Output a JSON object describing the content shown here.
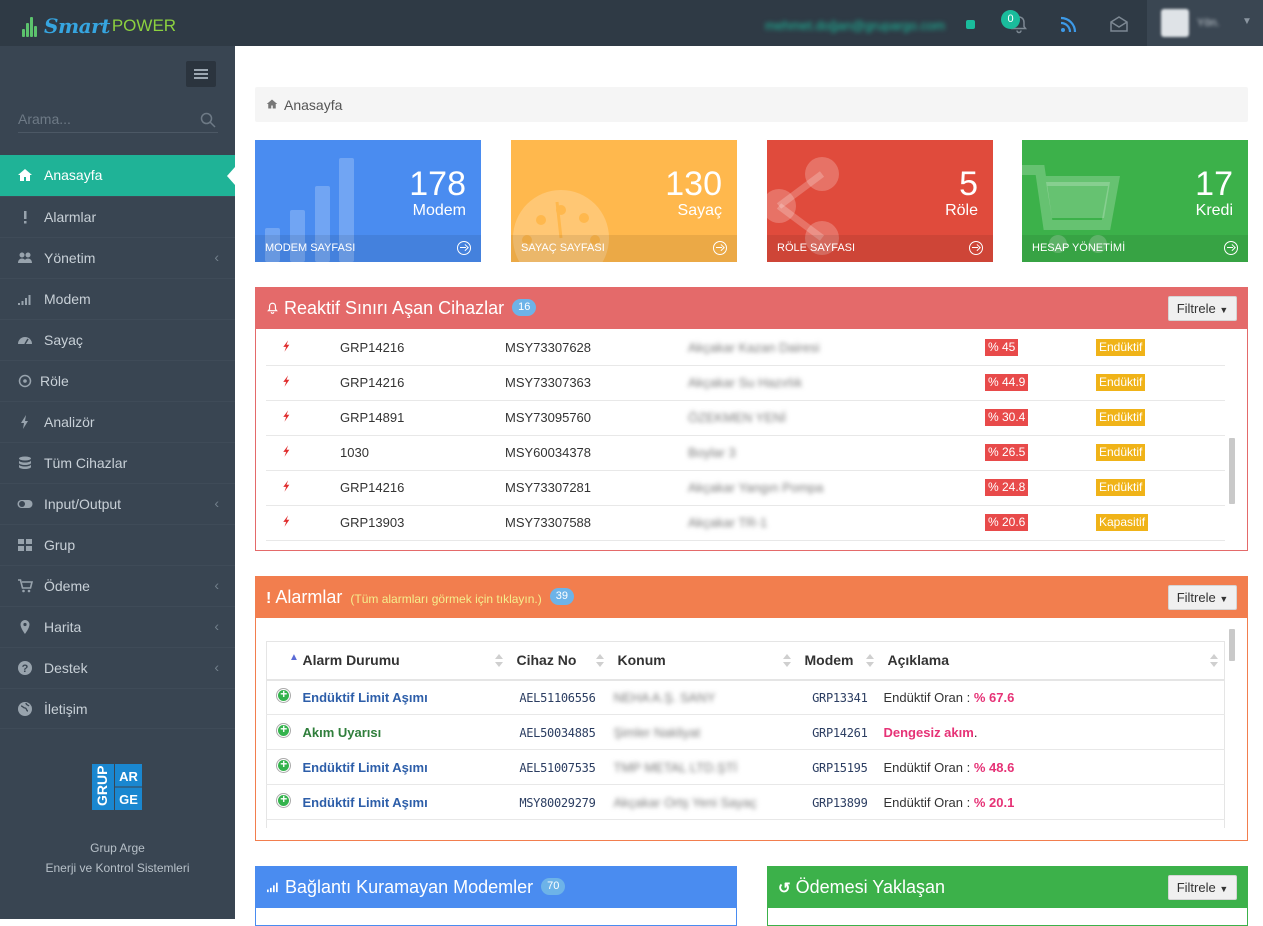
{
  "app": {
    "logo_text_1": "Smart",
    "logo_text_2": "POWER"
  },
  "topbar": {
    "email": "mehmet.doğan@grupargo.com",
    "notif_count": "0",
    "username": "Yön."
  },
  "sidebar": {
    "search_placeholder": "Arama...",
    "items": [
      {
        "label": "Anasayfa",
        "icon": "home-icon",
        "active": true,
        "chevron": false
      },
      {
        "label": "Alarmlar",
        "icon": "exclamation-icon",
        "chevron": false
      },
      {
        "label": "Yönetim",
        "icon": "users-icon",
        "chevron": true
      },
      {
        "label": "Modem",
        "icon": "signal-icon",
        "chevron": false
      },
      {
        "label": "Sayaç",
        "icon": "gauge-icon",
        "chevron": false
      },
      {
        "label": "Röle",
        "icon": "relay-icon",
        "chevron": false
      },
      {
        "label": "Analizör",
        "icon": "bolt-icon",
        "chevron": false
      },
      {
        "label": "Tüm Cihazlar",
        "icon": "database-icon",
        "chevron": false
      },
      {
        "label": "Input/Output",
        "icon": "toggle-icon",
        "chevron": true
      },
      {
        "label": "Grup",
        "icon": "grid-icon",
        "chevron": false
      },
      {
        "label": "Ödeme",
        "icon": "cart-icon",
        "chevron": true
      },
      {
        "label": "Harita",
        "icon": "map-marker-icon",
        "chevron": true
      },
      {
        "label": "Destek",
        "icon": "question-icon",
        "chevron": true
      },
      {
        "label": "İletişim",
        "icon": "globe-icon",
        "chevron": false
      }
    ],
    "brand_logo": {
      "g1": "GRUP",
      "g2": "AR",
      "g3": "GE"
    },
    "company_line1": "Grup Arge",
    "company_line2": "Enerji ve Kontrol Sistemleri"
  },
  "breadcrumb": {
    "home": "Anasayfa"
  },
  "tiles": [
    {
      "number": "178",
      "label": "Modem",
      "footer": "MODEM SAYFASI",
      "color": "#4a8cf0"
    },
    {
      "number": "130",
      "label": "Sayaç",
      "footer": "SAYAÇ SAYFASI",
      "color": "#ffb84d"
    },
    {
      "number": "5",
      "label": "Röle",
      "footer": "RÖLE SAYFASI",
      "color": "#e04b3c"
    },
    {
      "number": "17",
      "label": "Kredi",
      "footer": "HESAP YÖNETİMİ",
      "color": "#3cb14a"
    }
  ],
  "reactive": {
    "title": "Reaktif Sınırı Aşan Cihazlar",
    "count": "16",
    "filter_label": "Filtrele",
    "rows": [
      {
        "group": "GRP14216",
        "device": "MSY73307628",
        "location": "Akçakar Kazan Dairesi",
        "pct": "% 45",
        "type": "Endüktif"
      },
      {
        "group": "GRP14216",
        "device": "MSY73307363",
        "location": "Akçakar Su Hazırlık",
        "pct": "% 44.9",
        "type": "Endüktif"
      },
      {
        "group": "GRP14891",
        "device": "MSY73095760",
        "location": "ÖZEKMEN YENİ",
        "pct": "% 30.4",
        "type": "Endüktif"
      },
      {
        "group": "1030",
        "device": "MSY60034378",
        "location": "Boylar 3",
        "pct": "% 26.5",
        "type": "Endüktif"
      },
      {
        "group": "GRP14216",
        "device": "MSY73307281",
        "location": "Akçakar Yangın Pompa",
        "pct": "% 24.8",
        "type": "Endüktif"
      },
      {
        "group": "GRP13903",
        "device": "MSY73307588",
        "location": "Akçakar TR-1",
        "pct": "% 20.6",
        "type": "Kapasitif"
      }
    ]
  },
  "alarms": {
    "title": "Alarmlar",
    "subtitle": "(Tüm alarmları görmek için tıklayın.)",
    "count": "39",
    "filter_label": "Filtrele",
    "columns": [
      "Alarm Durumu",
      "Cihaz No",
      "Konum",
      "Modem",
      "Açıklama"
    ],
    "rows": [
      {
        "status": "Endüktif Limit Aşımı",
        "device": "AEL51106556",
        "location": "NEHA A.Ş. SANY",
        "modem": "GRP13341",
        "desc_prefix": "Endüktif Oran : ",
        "desc_value": "% 67.6",
        "desc_suffix": "",
        "status_color": "blue"
      },
      {
        "status": "Akım Uyarısı",
        "device": "AEL50034885",
        "location": "Şimler Nakliyat",
        "modem": "GRP14261",
        "desc_prefix": "",
        "desc_value": "Dengesiz akım",
        "desc_suffix": ".",
        "status_color": "green"
      },
      {
        "status": "Endüktif Limit Aşımı",
        "device": "AEL51007535",
        "location": "TMP METAL LTD.ŞTİ",
        "modem": "GRP15195",
        "desc_prefix": "Endüktif Oran : ",
        "desc_value": "% 48.6",
        "desc_suffix": "",
        "status_color": "blue"
      },
      {
        "status": "Endüktif Limit Aşımı",
        "device": "MSY80029279",
        "location": "Akçakar Ortş Yeni Sayaç",
        "modem": "GRP13899",
        "desc_prefix": "Endüktif Oran : ",
        "desc_value": "% 20.1",
        "desc_suffix": "",
        "status_color": "blue"
      }
    ]
  },
  "bottom_panels": {
    "modems": {
      "title": "Bağlantı Kuramayan Modemler",
      "count": "70"
    },
    "payment": {
      "title": "Ödemesi Yaklaşan",
      "filter_label": "Filtrele"
    }
  }
}
